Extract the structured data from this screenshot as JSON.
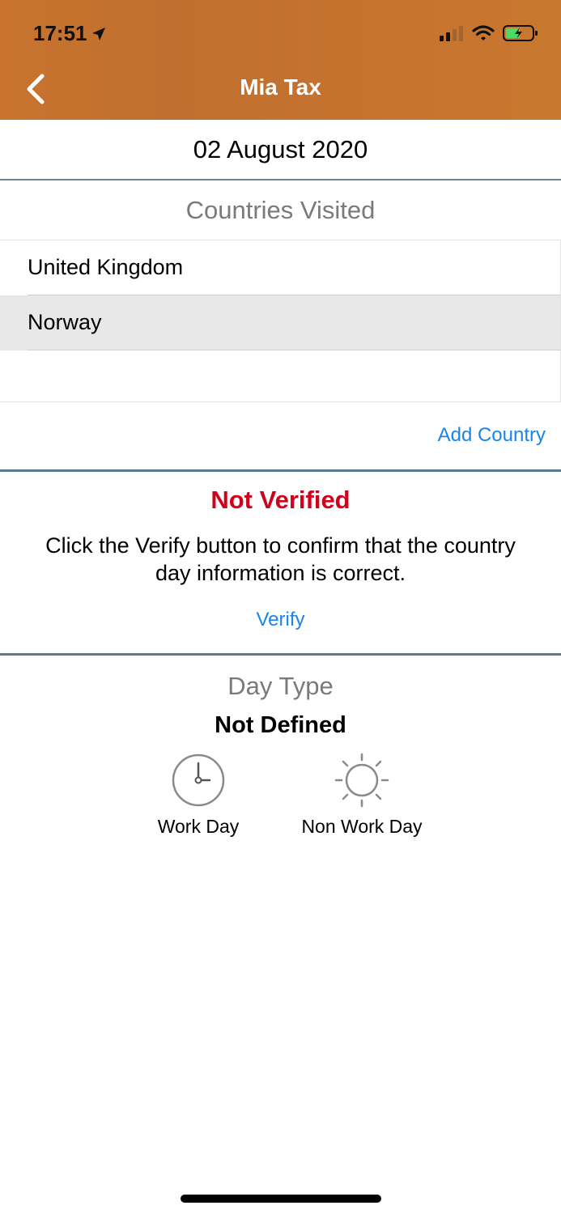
{
  "status_bar": {
    "time": "17:51"
  },
  "nav": {
    "title": "Mia Tax"
  },
  "date": "02 August 2020",
  "countries": {
    "title": "Countries Visited",
    "items": [
      {
        "label": "United Kingdom"
      },
      {
        "label": "Norway"
      }
    ],
    "add_label": "Add Country"
  },
  "verification": {
    "status": "Not Verified",
    "message": "Click the Verify button to confirm that the country day information is correct.",
    "verify_label": "Verify"
  },
  "day_type": {
    "title": "Day Type",
    "value": "Not Defined",
    "options": [
      {
        "label": "Work Day",
        "icon": "clock-icon"
      },
      {
        "label": "Non Work Day",
        "icon": "sun-icon"
      }
    ]
  },
  "colors": {
    "header": "#c5722f",
    "link": "#1a85e8",
    "error": "#d0021b",
    "divider": "#5d7b8f"
  }
}
